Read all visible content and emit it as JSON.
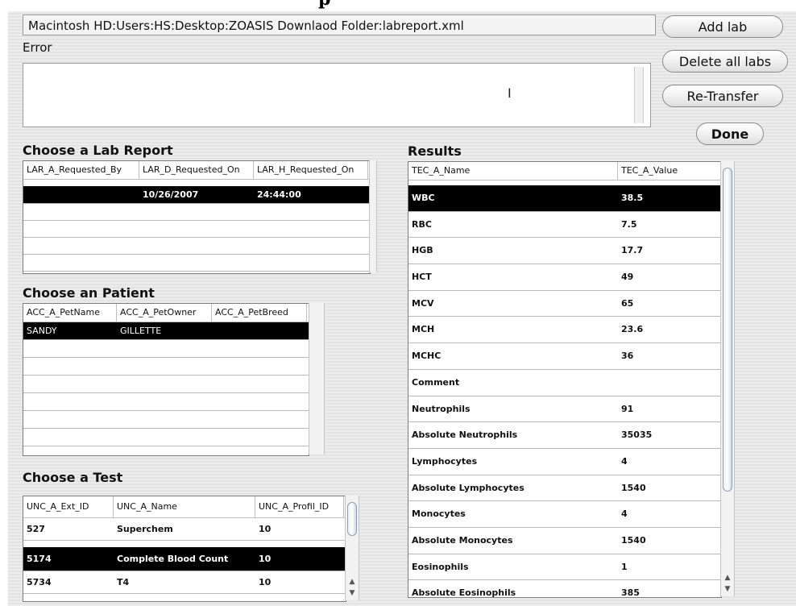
{
  "title_fragment": "p",
  "path_value": "Macintosh HD:Users:HS:Desktop:ZOASIS Downlaod Folder:labreport.xml",
  "error_label": "Error",
  "buttons": {
    "add_lab": "Add lab",
    "delete_all_labs": "Delete all labs",
    "re_transfer": "Re-Transfer",
    "done": "Done"
  },
  "lab_report": {
    "title": "Choose a Lab Report",
    "columns": [
      "LAR_A_Requested_By",
      "LAR_D_Requested_On",
      "LAR_H_Requested_On"
    ],
    "rows": [
      [
        "",
        "10/26/2007",
        "24:44:00"
      ]
    ]
  },
  "patient": {
    "title": "Choose an Patient",
    "columns": [
      "ACC_A_PetName",
      "ACC_A_PetOwner",
      "ACC_A_PetBreed"
    ],
    "rows": [
      [
        "SANDY",
        "GILLETTE",
        ""
      ]
    ]
  },
  "test": {
    "title": "Choose a Test",
    "columns": [
      "UNC_A_Ext_ID",
      "UNC_A_Name",
      "UNC_A_Profil_ID"
    ],
    "rows": [
      [
        "527",
        "Superchem",
        "10"
      ],
      [
        "5174",
        "Complete Blood Count",
        "10"
      ],
      [
        "5734",
        "T4",
        "10"
      ]
    ]
  },
  "results": {
    "title": "Results",
    "columns": [
      "TEC_A_Name",
      "TEC_A_Value"
    ],
    "rows": [
      [
        "WBC",
        "38.5"
      ],
      [
        "RBC",
        "7.5"
      ],
      [
        "HGB",
        "17.7"
      ],
      [
        "HCT",
        "49"
      ],
      [
        "MCV",
        "65"
      ],
      [
        "MCH",
        "23.6"
      ],
      [
        "MCHC",
        "36"
      ],
      [
        "Comment",
        ""
      ],
      [
        "Neutrophils",
        "91"
      ],
      [
        "Absolute Neutrophils",
        "35035"
      ],
      [
        "Lymphocytes",
        "4"
      ],
      [
        "Absolute Lymphocytes",
        "1540"
      ],
      [
        "Monocytes",
        "4"
      ],
      [
        "Absolute Monocytes",
        "1540"
      ],
      [
        "Eosinophils",
        "1"
      ],
      [
        "Absolute Eosinophils",
        "385"
      ]
    ]
  },
  "icons": {
    "text_cursor": "ibeam-cursor-icon",
    "scroll_up": "scroll-up-arrow-icon",
    "scroll_down": "scroll-down-arrow-icon"
  }
}
